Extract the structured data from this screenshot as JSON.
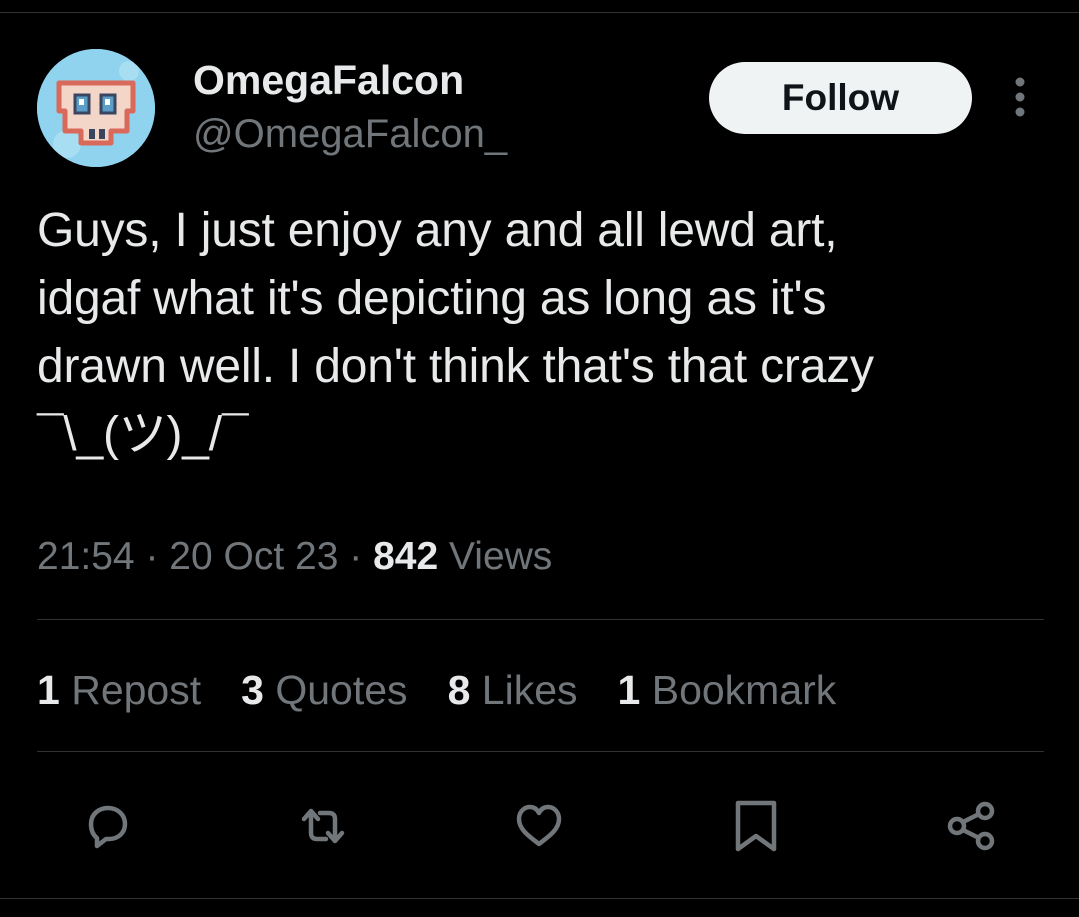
{
  "author": {
    "display_name": "OmegaFalcon",
    "handle": "@OmegaFalcon_",
    "avatar_icon": "robot-face-avatar"
  },
  "follow_label": "Follow",
  "tweet": {
    "text": "Guys, I just enjoy any and all lewd art,\nidgaf what it's depicting as long as it's\ndrawn well. I don't think that's that crazy\n¯\\_(ツ)_/¯"
  },
  "meta": {
    "time": "21:54",
    "date": "20 Oct 23",
    "views_count": "842",
    "views_label": "Views"
  },
  "stats": [
    {
      "count": "1",
      "label": "Repost"
    },
    {
      "count": "3",
      "label": "Quotes"
    },
    {
      "count": "8",
      "label": "Likes"
    },
    {
      "count": "1",
      "label": "Bookmark"
    }
  ],
  "actions": [
    "reply-icon",
    "repost-icon",
    "like-icon",
    "bookmark-icon",
    "share-icon"
  ],
  "colors": {
    "background": "#000000",
    "primary_text": "#e7e9ea",
    "secondary_text": "#71767b",
    "divider": "#2f3336",
    "follow_button_bg": "#eff3f4",
    "avatar_bg": "#8fd3ee"
  }
}
